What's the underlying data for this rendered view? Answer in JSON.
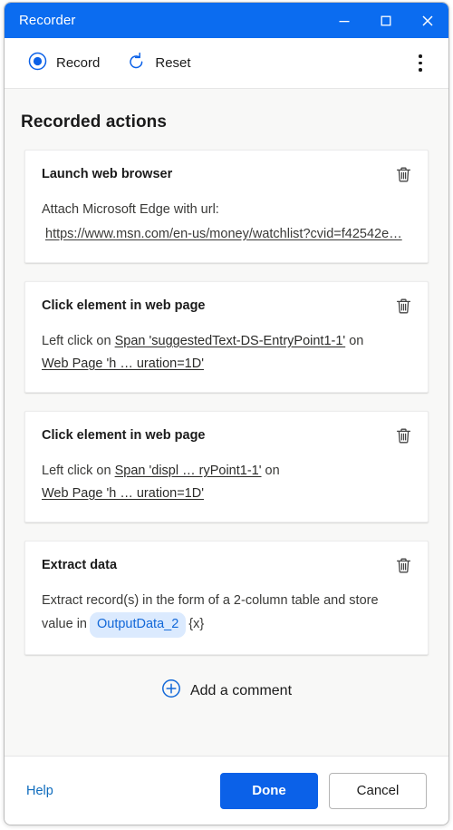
{
  "window": {
    "title": "Recorder",
    "controls": [
      {
        "name": "minimize-button",
        "glyph": "minimize"
      },
      {
        "name": "maximize-button",
        "glyph": "maximize"
      },
      {
        "name": "close-button",
        "glyph": "close"
      }
    ],
    "accent_color": "#0b6cf0",
    "border_color": "#bdbdbd"
  },
  "toolbar": {
    "record_label": "Record",
    "record_icon": "record-circle-icon",
    "reset_label": "Reset",
    "reset_icon": "reset-arrow-icon",
    "more_icon": "more-vertical-icon"
  },
  "main": {
    "section_title": "Recorded actions",
    "delete_icon": "trash-icon",
    "cards": [
      {
        "title": "Launch web browser",
        "desc_prefix": "Attach Microsoft Edge with url:",
        "url": "https://www.msn.com/en-us/money/watchlist?cvid=f42542e…"
      },
      {
        "title": "Click element in web page",
        "line1_prefix": "Left click on ",
        "line1_selector": "Span 'suggestedText-DS-EntryPoint1-1'",
        "line1_suffix": " on",
        "line2_selector": "Web Page 'h … uration=1D'"
      },
      {
        "title": "Click element in web page",
        "line1_prefix": "Left click on ",
        "line1_selector": "Span 'displ … ryPoint1-1'",
        "line1_suffix": " on",
        "line2_selector": "Web Page 'h … uration=1D'"
      },
      {
        "title": "Extract data",
        "extract_text_1": "Extract record(s) in the form of a 2-column table and store",
        "extract_text_2": "value in",
        "variable_chip": "OutputData_2",
        "variable_marker": "{x}",
        "chip_bg": "#dbeafe",
        "chip_text_color": "#1268d8"
      }
    ],
    "add_comment_label": "Add a comment",
    "add_comment_icon": "plus-circle-icon"
  },
  "footer": {
    "help_label": "Help",
    "done_label": "Done",
    "cancel_label": "Cancel",
    "done_color": "#0b61e8",
    "help_color": "#0f6cbd"
  }
}
